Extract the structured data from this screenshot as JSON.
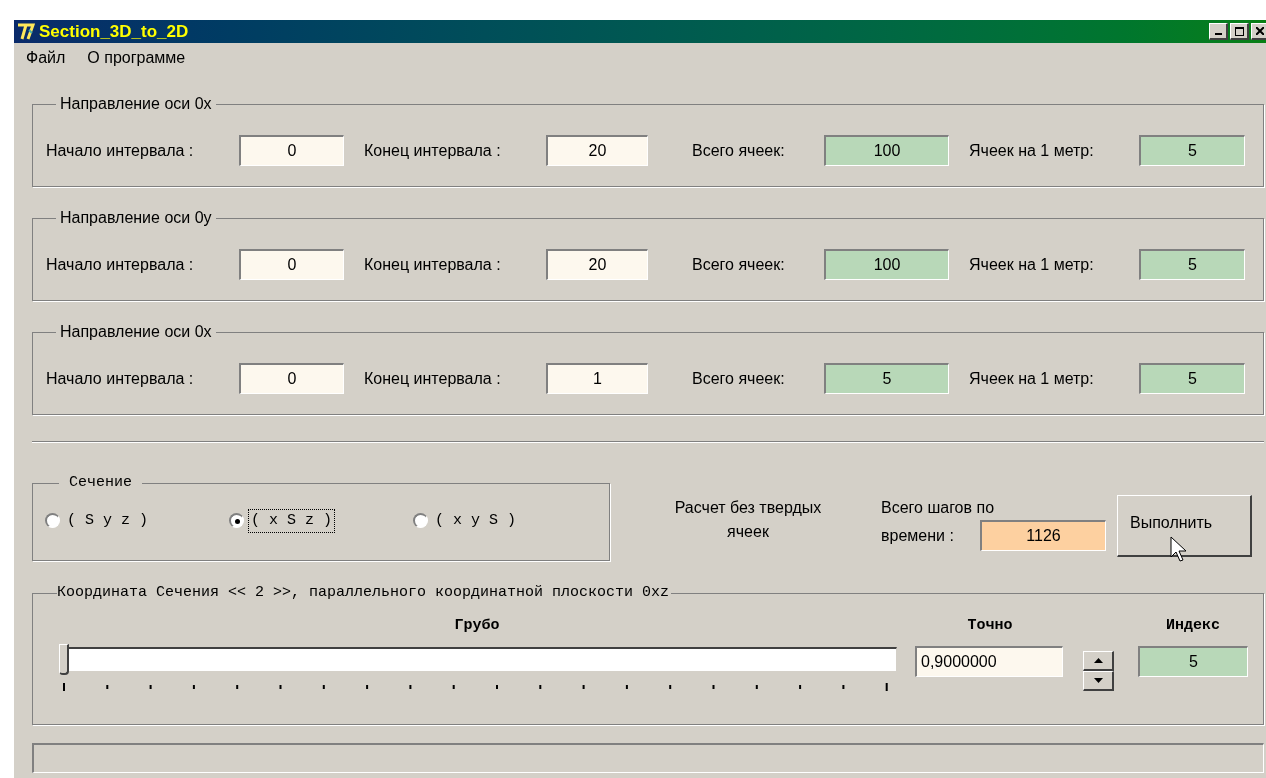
{
  "window": {
    "title": "Section_3D_to_2D"
  },
  "menu": [
    "Файл",
    "О программе"
  ],
  "axis_groups": [
    {
      "title": "Направление оси 0x",
      "start_label": "Начало интервала :",
      "start_value": "0",
      "end_label": "Конец интервала :",
      "end_value": "20",
      "total_label": "Всего ячеек:",
      "total_value": "100",
      "per_meter_label": "Ячеек на 1 метр:",
      "per_meter_value": "5"
    },
    {
      "title": "Направление оси 0y",
      "start_label": "Начало интервала :",
      "start_value": "0",
      "end_label": "Конец интервала :",
      "end_value": "20",
      "total_label": "Всего ячеек:",
      "total_value": "100",
      "per_meter_label": "Ячеек на 1 метр:",
      "per_meter_value": "5"
    },
    {
      "title": "Направление оси 0x",
      "start_label": "Начало интервала :",
      "start_value": "0",
      "end_label": "Конец интервала :",
      "end_value": "1",
      "total_label": "Всего ячеек:",
      "total_value": "5",
      "per_meter_label": "Ячеек на 1 метр:",
      "per_meter_value": "5"
    }
  ],
  "section": {
    "title": "Сечение",
    "options": [
      {
        "label": "( S y z )",
        "selected": false
      },
      {
        "label": "( x S z )",
        "selected": true
      },
      {
        "label": "( x y S )",
        "selected": false
      }
    ]
  },
  "calc_note": "Расчет без твердых ячеек",
  "steps": {
    "label_lines": [
      "Всего шагов по",
      "времени :"
    ],
    "value": "1126"
  },
  "run_button": "Выполнить",
  "coordinate": {
    "title": "Координата Сечения << 2 >>, параллельного координатной плоскости 0xz",
    "coarse_label": "Грубо",
    "slider": {
      "level": 0
    },
    "precise_label": "Точно",
    "precise_value": "0,9000000",
    "index_label": "Индекс",
    "index_value": "5"
  }
}
